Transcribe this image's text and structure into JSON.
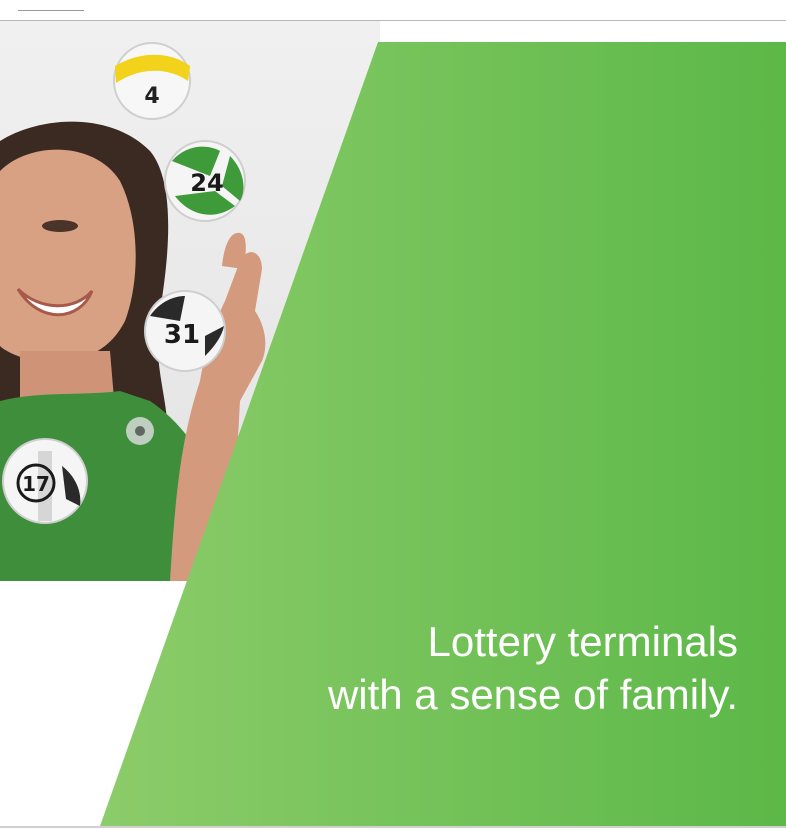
{
  "tagline": {
    "line1": "Lottery terminals",
    "line2": "with a sense of family."
  },
  "balls": [
    {
      "number": "4",
      "icon": "lottery-ball-yellow-band"
    },
    {
      "number": "24",
      "icon": "lottery-ball-green"
    },
    {
      "number": "31",
      "icon": "lottery-ball-white"
    },
    {
      "number": "17",
      "icon": "lottery-ball-white"
    }
  ],
  "colors": {
    "panel_green_dark": "#5cb848",
    "panel_green_light": "#8ccc6a",
    "text": "#ffffff",
    "shirt_green": "#3e8e3c"
  }
}
